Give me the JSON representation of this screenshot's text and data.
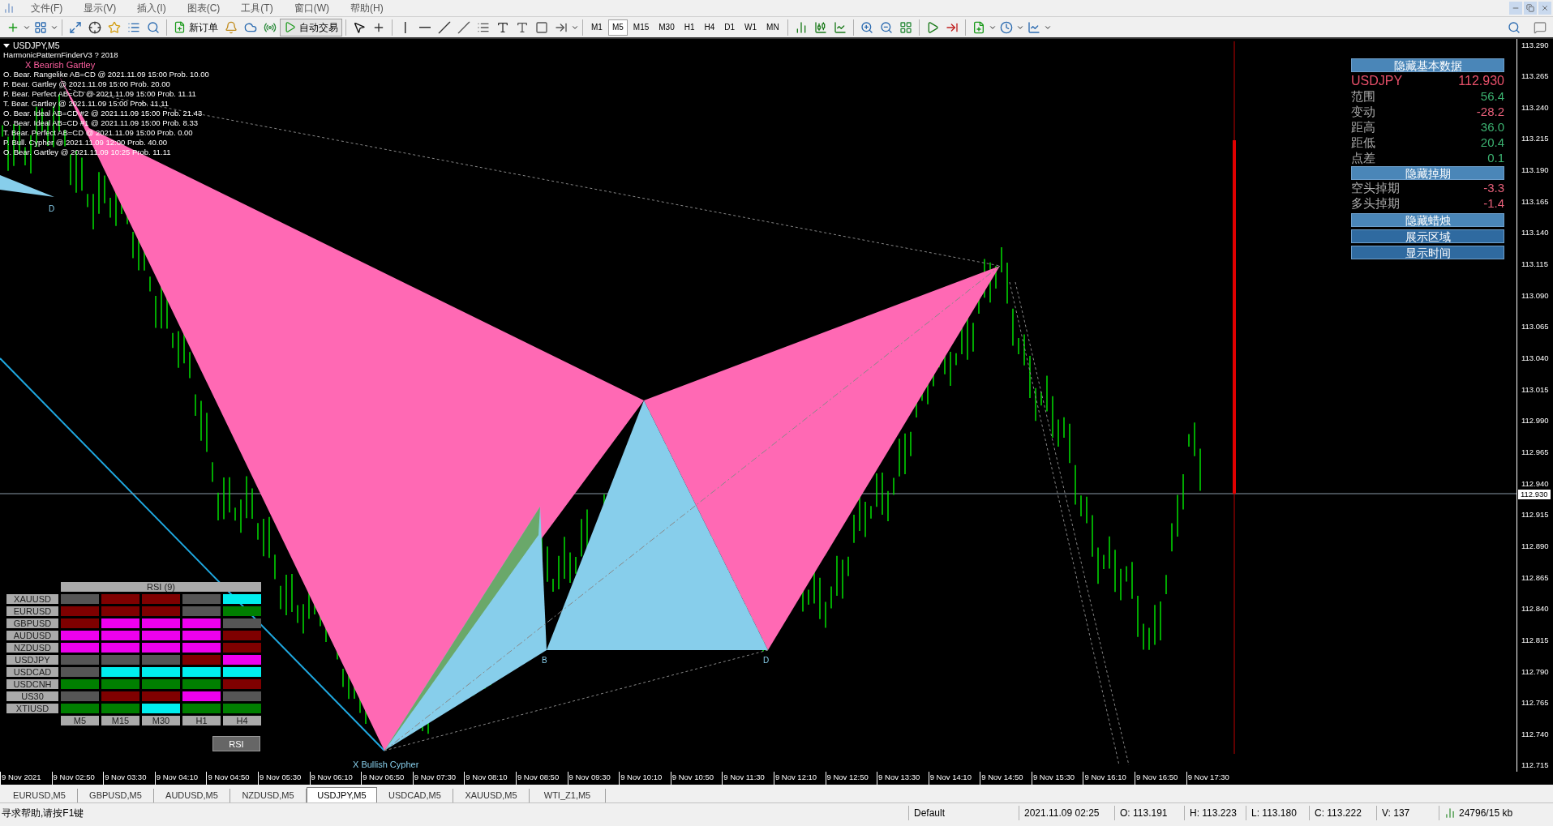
{
  "menu": [
    "文件(F)",
    "显示(V)",
    "插入(I)",
    "图表(C)",
    "工具(T)",
    "窗口(W)",
    "帮助(H)"
  ],
  "toolbar": {
    "new_order": "新订单",
    "auto_trading": "自动交易",
    "timeframes": [
      {
        "label": "M1",
        "selected": false
      },
      {
        "label": "M5",
        "selected": true
      },
      {
        "label": "M15",
        "selected": false
      },
      {
        "label": "M30",
        "selected": false
      },
      {
        "label": "H1",
        "selected": false
      },
      {
        "label": "H4",
        "selected": false
      },
      {
        "label": "D1",
        "selected": false
      },
      {
        "label": "W1",
        "selected": false
      },
      {
        "label": "MN",
        "selected": false
      }
    ]
  },
  "chart": {
    "title": "USDJPY,M5",
    "indicator": "HarmonicPatternFinderV3 ? 2018",
    "pattern_title": "X Bearish Gartley",
    "patterns": [
      "O. Bear. Rangelike AB=CD @ 2021.11.09 15:00 Prob. 10.00",
      "P. Bear. Gartley @ 2021.11.09 15:00 Prob. 20.00",
      "P. Bear. Perfect AB=CD @ 2021.11.09 15:00 Prob. 11.11",
      "T. Bear. Gartley @ 2021.11.09 15:00 Prob. 11.11",
      "O. Bear. Ideal AB=CD #2 @ 2021.11.09 15:00 Prob. 21.43",
      "O. Bear. Ideal AB=CD #1 @ 2021.11.09 15:00 Prob. 8.33",
      "T. Bear. Perfect AB=CD @ 2021.11.09 15:00 Prob. 0.00",
      "P. Bull. Cypher @ 2021.11.09 12:00 Prob. 40.00",
      "O. Bear. Gartley @ 2021.11.09 10:25 Prob. 11.11"
    ],
    "point_labels": [
      "D",
      "B",
      "D"
    ],
    "cypher_label": "X Bullish Cypher",
    "price_axis": [
      "113.290",
      "113.265",
      "113.240",
      "113.215",
      "113.190",
      "113.165",
      "113.140",
      "113.115",
      "113.090",
      "113.065",
      "113.040",
      "113.015",
      "112.990",
      "112.965",
      "112.940",
      "112.915",
      "112.890",
      "112.865",
      "112.840",
      "112.815",
      "112.790",
      "112.765",
      "112.740",
      "112.715"
    ],
    "current_price": "112.930",
    "time_axis": [
      "9 Nov 2021",
      "9 Nov 02:50",
      "9 Nov 03:30",
      "9 Nov 04:10",
      "9 Nov 04:50",
      "9 Nov 05:30",
      "9 Nov 06:10",
      "9 Nov 06:50",
      "9 Nov 07:30",
      "9 Nov 08:10",
      "9 Nov 08:50",
      "9 Nov 09:30",
      "9 Nov 10:10",
      "9 Nov 10:50",
      "9 Nov 11:30",
      "9 Nov 12:10",
      "9 Nov 12:50",
      "9 Nov 13:30",
      "9 Nov 14:10",
      "9 Nov 14:50",
      "9 Nov 15:30",
      "9 Nov 16:10",
      "9 Nov 16:50",
      "9 Nov 17:30"
    ]
  },
  "info_panel": {
    "hide_basic_button": "隐藏基本数据",
    "symbol": "USDJPY",
    "price": "112.930",
    "rows": [
      {
        "label": "范围",
        "value": "56.4",
        "color": "#3cb371"
      },
      {
        "label": "变动",
        "value": "-28.2",
        "color": "#e8607a"
      },
      {
        "label": "距高",
        "value": "36.0",
        "color": "#3cb371"
      },
      {
        "label": "距低",
        "value": "20.4",
        "color": "#3cb371"
      },
      {
        "label": "点差",
        "value": "0.1",
        "color": "#3cb371"
      }
    ],
    "hide_swap_button": "隐藏掉期",
    "swap_rows": [
      {
        "label": "空头掉期",
        "value": "-3.3",
        "color": "#e8607a"
      },
      {
        "label": "多头掉期",
        "value": "-1.4",
        "color": "#e8607a"
      }
    ],
    "buttons": [
      "隐藏蜡烛",
      "展示区域",
      "显示时间"
    ]
  },
  "rsi": {
    "title": "RSI (9)",
    "rows": [
      {
        "symbol": "XAUUSD",
        "cells": [
          {
            "color": "#555555"
          },
          {
            "color": "#7f0000"
          },
          {
            "color": "#7f0000"
          },
          {
            "color": "#555555"
          },
          {
            "color": "#00eeee"
          }
        ]
      },
      {
        "symbol": "EURUSD",
        "cells": [
          {
            "color": "#7f0000"
          },
          {
            "color": "#7f0000"
          },
          {
            "color": "#7f0000"
          },
          {
            "color": "#555555"
          },
          {
            "color": "#007f00"
          }
        ]
      },
      {
        "symbol": "GBPUSD",
        "cells": [
          {
            "color": "#7f0000"
          },
          {
            "color": "#ee00ee"
          },
          {
            "color": "#ee00ee"
          },
          {
            "color": "#ee00ee"
          },
          {
            "color": "#555555"
          }
        ]
      },
      {
        "symbol": "AUDUSD",
        "cells": [
          {
            "color": "#ee00ee"
          },
          {
            "color": "#ee00ee"
          },
          {
            "color": "#ee00ee"
          },
          {
            "color": "#ee00ee"
          },
          {
            "color": "#7f0000"
          }
        ]
      },
      {
        "symbol": "NZDUSD",
        "cells": [
          {
            "color": "#ee00ee"
          },
          {
            "color": "#ee00ee"
          },
          {
            "color": "#ee00ee"
          },
          {
            "color": "#ee00ee"
          },
          {
            "color": "#7f0000"
          }
        ]
      },
      {
        "symbol": "USDJPY",
        "cells": [
          {
            "color": "#555555"
          },
          {
            "color": "#555555"
          },
          {
            "color": "#555555"
          },
          {
            "color": "#7f0000"
          },
          {
            "color": "#ee00ee"
          }
        ]
      },
      {
        "symbol": "USDCAD",
        "cells": [
          {
            "color": "#555555"
          },
          {
            "color": "#00eeee"
          },
          {
            "color": "#00eeee"
          },
          {
            "color": "#00eeee"
          },
          {
            "color": "#00eeee"
          }
        ]
      },
      {
        "symbol": "USDCNH",
        "cells": [
          {
            "color": "#007f00"
          },
          {
            "color": "#007f00"
          },
          {
            "color": "#007f00"
          },
          {
            "color": "#007f00"
          },
          {
            "color": "#7f0000"
          }
        ]
      },
      {
        "symbol": "US30",
        "cells": [
          {
            "color": "#555555"
          },
          {
            "color": "#7f0000"
          },
          {
            "color": "#7f0000"
          },
          {
            "color": "#ee00ee"
          },
          {
            "color": "#555555"
          }
        ]
      },
      {
        "symbol": "XTIUSD",
        "cells": [
          {
            "color": "#007f00"
          },
          {
            "color": "#007f00"
          },
          {
            "color": "#00eeee"
          },
          {
            "color": "#007f00"
          },
          {
            "color": "#007f00"
          }
        ]
      }
    ],
    "columns": [
      "M5",
      "M15",
      "M30",
      "H1",
      "H4"
    ],
    "button": "RSI"
  },
  "tabs": [
    {
      "label": "EURUSD,M5",
      "selected": false
    },
    {
      "label": "GBPUSD,M5",
      "selected": false
    },
    {
      "label": "AUDUSD,M5",
      "selected": false
    },
    {
      "label": "NZDUSD,M5",
      "selected": false
    },
    {
      "label": "USDJPY,M5",
      "selected": true
    },
    {
      "label": "USDCAD,M5",
      "selected": false
    },
    {
      "label": "XAUUSD,M5",
      "selected": false
    },
    {
      "label": "WTI_Z1,M5",
      "selected": false
    }
  ],
  "status_bar": {
    "help": "寻求帮助,请按F1键",
    "profile": "Default",
    "time": "2021.11.09 02:25",
    "open": "O: 113.191",
    "high": "H: 113.223",
    "low": "L: 113.180",
    "close": "C: 113.222",
    "volume": "V: 137",
    "traffic": "24796/15 kb"
  }
}
